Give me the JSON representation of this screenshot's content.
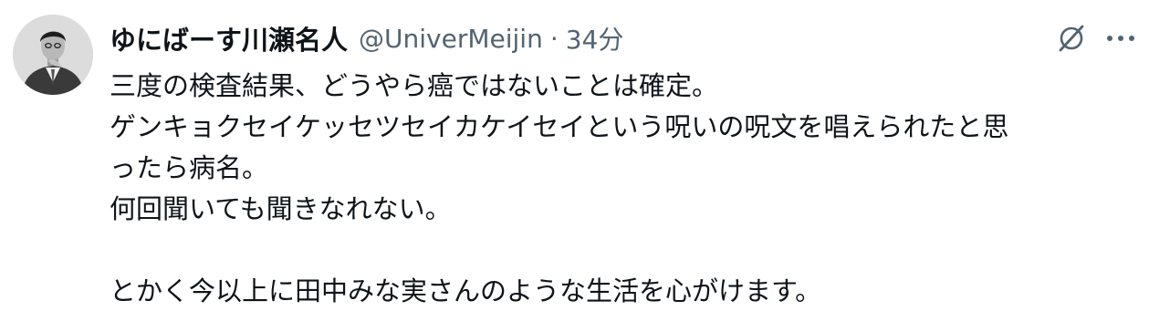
{
  "tweet": {
    "author": {
      "display_name": "ゆにばーす川瀬名人",
      "handle": "@UniverMeijin",
      "separator": "·",
      "time": "34分"
    },
    "icons": {
      "grok": "grok-icon",
      "more": "more-horizontal-icon"
    },
    "body": {
      "line1": "三度の検査結果、どうやら癌ではないことは確定。",
      "line2": "ゲンキョクセイケッセツセイカケイセイという呪いの呪文を唱えられたと思",
      "line3": "ったら病名。",
      "line4": "何回聞いても聞きなれない。",
      "line5": "",
      "line6": "とかく今以上に田中みな実さんのような生活を心がけます。"
    }
  }
}
